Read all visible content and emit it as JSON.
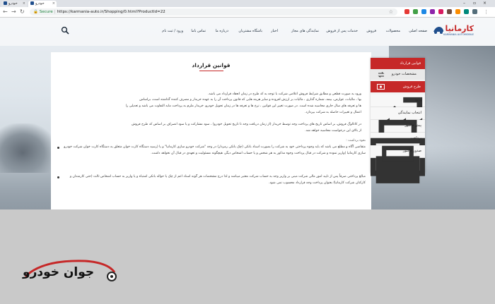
{
  "browser": {
    "tabs": [
      {
        "title": "خودرو"
      },
      {
        "title": "خودرو"
      }
    ],
    "secure_label": "Secure",
    "url": "https://karmania-auto.ir/Shopping/0.html?ProductId=22"
  },
  "site": {
    "logo_text": "کارمانیا",
    "logo_sub": "KARMANIA AUTOMOBILE",
    "menu": [
      "صفحه اصلی",
      "محصولات",
      "فروش",
      "خدمات پس از فروش",
      "نمایندگی های مجاز",
      "اخبار",
      "باشگاه مشتریان",
      "درباره ما",
      "تماس باما",
      "ورود / ثبت نام"
    ]
  },
  "content": {
    "title": "قوانین قرارداد",
    "paragraphs": [
      "ورود به صورت قطعی و مطابق شرایط فروش اعلامی شرکت با توجه به کد طرح در زمان انعقاد قرارداد می باشد.",
      "بها ، مالیات، عوارض، بیمه، شماره گذاری ، مالیات بر ارزش افزوده و سایر هزینه هایی که قانون پرداخت آن را به عهده خریدار و مصرف کننده گذاشته است، براساس",
      "ها و تعرفه های سال جاری محاسبه شده است. در صورت تغییر این قوانین ، نرخ ها و تعرفه ها در زمان تحویل خودرو، خریدار ملزم به پرداخت مابه التفاوت می باشد و تعدیلی را",
      "اعمال و تغییرات حاصله به شرکت بپردازد.",
      "در کاتالوگ فروش، بر اساس تاریخ های پرداخت وجه توسط خریدار (از زمان دریافت وجه تا تاریخ تحویل خودرو) ، سود مشارکت و یا سود انصراف بر اساس کد طرح فروش",
      "از بالای این درخواست محاسبه خواهد شد."
    ],
    "bullet_label": "نحوه برداشت :",
    "bullets": [
      "متقاضی آگاه و مطلع می باشد که باید وجوه پرداختی خود به شرکت را بصورت اسناد بانکی (چک بانکی رمزدار) در وجه \"شرکت خودرو سازی کارمانیا\" و یا (رسید دستگاه کارت خوان متعلق به دستگاه کارت خوان شرکت خودرو سازی کارمانیا )واریز نموده و شرکت در قبال پرداخت وجوه مذکور به هر شخص و یا حساب اشخاص دیگر، هیچگونه مسئولیت و تعهدی در قبال آن نخواهد داشت.",
      "مبالغ پرداختی صرفاً پس از تایید امور مالی شرکت مبنی بر واریز وجه به حساب شرکت معتبر میباشد و لذا درج مشخصات هر گونه اسناد اعم از چک یا حواله بانکی اشتباه و یا واریز به حساب اشخاص ثالث (حتی کارمندان و کارکنان شرکت کارمانیا) بعنوان پرداخت وجه قرارداد محسوب نمی شود."
    ]
  },
  "sidebar": {
    "sections": [
      {
        "label": "قوانین قرارداد"
      },
      {
        "label": "مشخصات خودرو"
      },
      {
        "label": "طرح فروش"
      }
    ],
    "steps": [
      {
        "label": "ورود"
      },
      {
        "label": "انتخاب نمایندگی"
      },
      {
        "label": "پیش فاکتور"
      },
      {
        "label": "پرداخت"
      },
      {
        "label": "صدور فاکتور"
      }
    ]
  },
  "watermark": {
    "text": "جوان خودرو"
  },
  "colors": {
    "accent": "#c62828",
    "brand_blue": "#1f4e8c"
  }
}
